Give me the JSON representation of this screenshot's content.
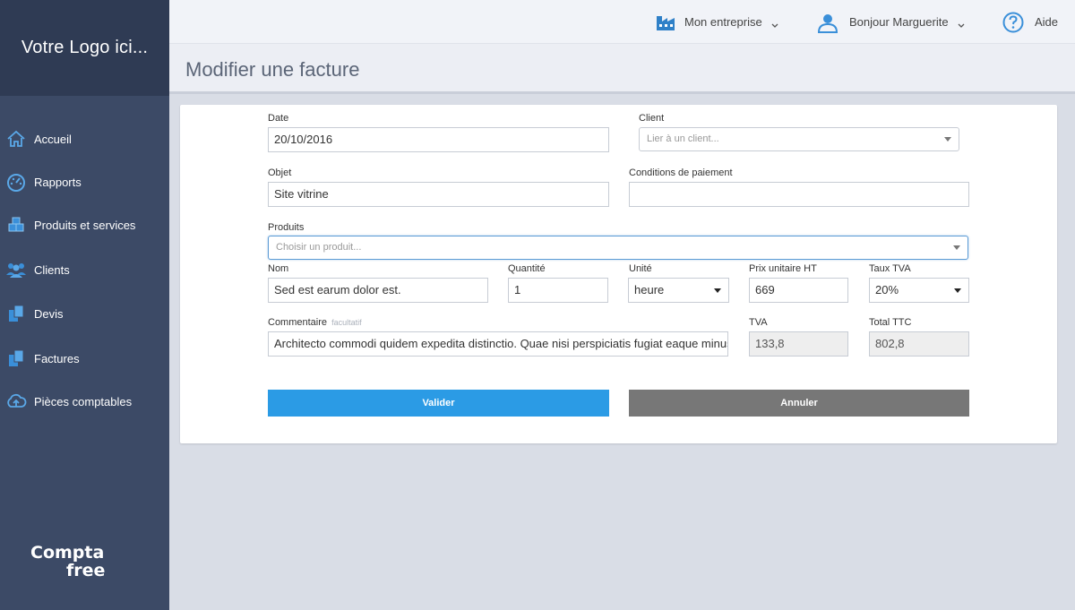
{
  "sidebar": {
    "logo_text": "Votre Logo ici...",
    "items": [
      {
        "label": "Accueil",
        "icon": "home-icon"
      },
      {
        "label": "Rapports",
        "icon": "dashboard-icon"
      },
      {
        "label": "Produits et services",
        "icon": "boxes-icon"
      },
      {
        "label": "Clients",
        "icon": "users-icon"
      },
      {
        "label": "Devis",
        "icon": "documents-icon"
      },
      {
        "label": "Factures",
        "icon": "documents-icon"
      },
      {
        "label": "Pièces comptables",
        "icon": "cloud-upload-icon"
      }
    ],
    "brand": {
      "line1": "Compta",
      "line2": "free"
    }
  },
  "topbar": {
    "company": "Mon entreprise",
    "user": "Bonjour Marguerite",
    "help": "Aide"
  },
  "page": {
    "title": "Modifier une facture"
  },
  "form": {
    "date": {
      "label": "Date",
      "value": "20/10/2016"
    },
    "client": {
      "label": "Client",
      "placeholder": "Lier à un client..."
    },
    "objet": {
      "label": "Objet",
      "value": "Site vitrine"
    },
    "conditions": {
      "label": "Conditions de paiement",
      "value": ""
    },
    "produits": {
      "label": "Produits",
      "placeholder": "Choisir un produit..."
    },
    "nom": {
      "label": "Nom",
      "value": "Sed est earum dolor est."
    },
    "quantite": {
      "label": "Quantité",
      "value": "1"
    },
    "unite": {
      "label": "Unité",
      "value": "heure"
    },
    "prix": {
      "label": "Prix unitaire HT",
      "value": "669"
    },
    "taux": {
      "label": "Taux TVA",
      "value": "20%"
    },
    "commentaire": {
      "label": "Commentaire",
      "optional": "facultatif",
      "value": "Architecto commodi quidem expedita distinctio. Quae nisi perspiciatis fugiat eaque minus"
    },
    "tva": {
      "label": "TVA",
      "value": "133,8"
    },
    "total": {
      "label": "Total TTC",
      "value": "802,8"
    },
    "validate_label": "Valider",
    "cancel_label": "Annuler"
  },
  "colors": {
    "sidebar_bg": "#3c4a66",
    "logo_bg": "#2f3b54",
    "primary": "#2b9be5",
    "secondary": "#777777",
    "icon_blue": "#3a8fd9"
  }
}
